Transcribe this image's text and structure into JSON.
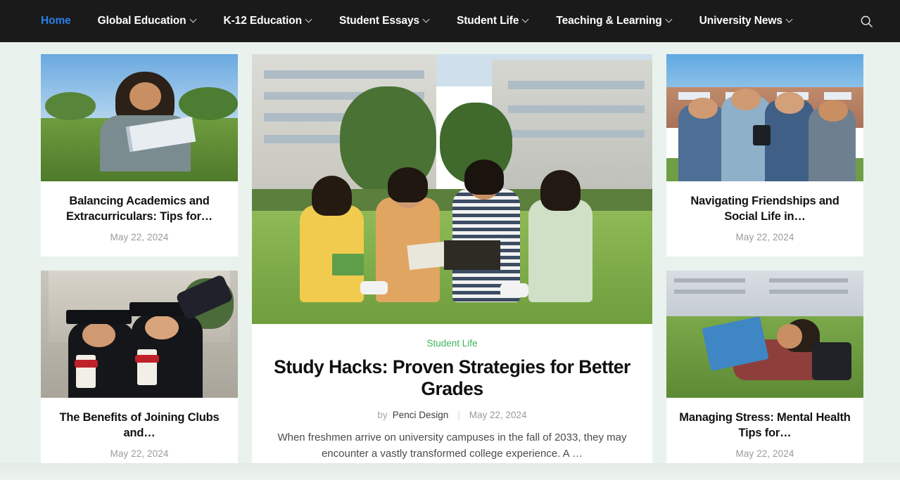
{
  "nav": {
    "items": [
      {
        "label": "Home",
        "has_dropdown": false,
        "active": true
      },
      {
        "label": "Global Education",
        "has_dropdown": true,
        "active": false
      },
      {
        "label": "K-12 Education",
        "has_dropdown": true,
        "active": false
      },
      {
        "label": "Student Essays",
        "has_dropdown": true,
        "active": false
      },
      {
        "label": "Student Life",
        "has_dropdown": true,
        "active": false
      },
      {
        "label": "Teaching & Learning",
        "has_dropdown": true,
        "active": false
      },
      {
        "label": "University News",
        "has_dropdown": true,
        "active": false
      }
    ],
    "search_icon": "search-icon",
    "active_color": "#2a7fe8",
    "bar_color": "#1a1a1a"
  },
  "colors": {
    "page_background": "#eaf2ed",
    "card_background": "#ffffff",
    "category_green": "#3cb55a",
    "title_text": "#121212",
    "meta_text": "#9a9a9a"
  },
  "left_column": [
    {
      "title": "Balancing Academics and Extracurriculars: Tips for…",
      "date": "May 22, 2024",
      "image_alt": "young-woman-reading-book-on-grass"
    },
    {
      "title": "The Benefits of Joining Clubs and…",
      "date": "May 22, 2024",
      "image_alt": "two-graduates-taking-selfie-with-diplomas"
    }
  ],
  "right_column": [
    {
      "title": "Navigating Friendships and Social Life in…",
      "date": "May 22, 2024",
      "image_alt": "group-of-friends-looking-at-phone-outside-campus"
    },
    {
      "title": "Managing Stress: Mental Health Tips for…",
      "date": "May 22, 2024",
      "image_alt": "student-lying-on-grass-with-blue-book"
    }
  ],
  "feature": {
    "category": "Student Life",
    "title": "Study Hacks: Proven Strategies for Better Grades",
    "by_label": "by",
    "author": "Penci Design",
    "separator": "|",
    "date": "May 22, 2024",
    "excerpt": "When freshmen arrive on university campuses in the fall of 2033, they may encounter a vastly transformed college experience. A …",
    "image_alt": "four-students-studying-together-on-campus-lawn"
  }
}
